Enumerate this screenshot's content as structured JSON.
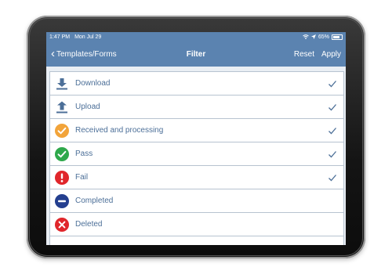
{
  "status": {
    "time": "1:47 PM",
    "date": "Mon Jul 29",
    "battery": "65%"
  },
  "nav": {
    "back_label": "Templates/Forms",
    "title": "Filter",
    "reset_label": "Reset",
    "apply_label": "Apply"
  },
  "colors": {
    "nav_bar": "#5b83b0",
    "label_text": "#4c6f98",
    "received": "#f2a43a",
    "pass": "#2ea84b",
    "fail": "#e0262b",
    "completed": "#243f8f",
    "deleted": "#e0262b"
  },
  "filters": [
    {
      "label": "Download",
      "icon": "download-icon",
      "checked": true
    },
    {
      "label": "Upload",
      "icon": "upload-icon",
      "checked": true
    },
    {
      "label": "Received and processing",
      "icon": "check-circle-icon",
      "checked": true
    },
    {
      "label": "Pass",
      "icon": "check-circle-icon",
      "checked": true
    },
    {
      "label": "Fail",
      "icon": "exclamation-circle-icon",
      "checked": true
    },
    {
      "label": "Completed",
      "icon": "minus-circle-icon",
      "checked": false
    },
    {
      "label": "Deleted",
      "icon": "x-circle-icon",
      "checked": false
    }
  ]
}
